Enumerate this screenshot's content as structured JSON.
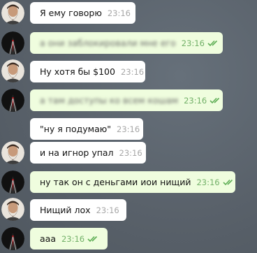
{
  "messages": [
    {
      "sender": "other",
      "avatar": "bearded-man-avatar",
      "text": "Я ему говорю",
      "time": "23:16",
      "blurred": false,
      "read": false
    },
    {
      "sender": "me",
      "avatar": "dark-suit-avatar",
      "text": "а они заблокировали мне его",
      "time": "23:16",
      "blurred": true,
      "read": true
    },
    {
      "sender": "other",
      "avatar": "bearded-man-avatar",
      "text": "Ну хотя бы $100",
      "time": "23:16",
      "blurred": false,
      "read": false
    },
    {
      "sender": "me",
      "avatar": "dark-suit-avatar",
      "text": "а там доступы ко всем кошам",
      "time": "23:16",
      "blurred": true,
      "read": true
    },
    {
      "sender": "other",
      "avatar": "",
      "text": "\"ну я подумаю\"",
      "time": "23:16",
      "blurred": false,
      "read": false
    },
    {
      "sender": "other",
      "avatar": "bearded-man-avatar",
      "text": "и на игнор упал",
      "time": "23:16",
      "blurred": false,
      "read": false
    },
    {
      "sender": "me",
      "avatar": "dark-suit-avatar",
      "text": "ну так он с деньгами иои нищий",
      "time": "23:16",
      "blurred": false,
      "read": true
    },
    {
      "sender": "other",
      "avatar": "bearded-man-avatar",
      "text": "Нищий лох",
      "time": "23:16",
      "blurred": false,
      "read": false
    },
    {
      "sender": "me",
      "avatar": "dark-suit-avatar",
      "text": "ааа",
      "time": "23:16",
      "blurred": false,
      "read": true
    }
  ],
  "colors": {
    "background": "#59616a",
    "incoming_bubble": "#ffffff",
    "outgoing_bubble": "#effdde",
    "outgoing_time": "#73b169",
    "read_check": "#5fae56"
  }
}
